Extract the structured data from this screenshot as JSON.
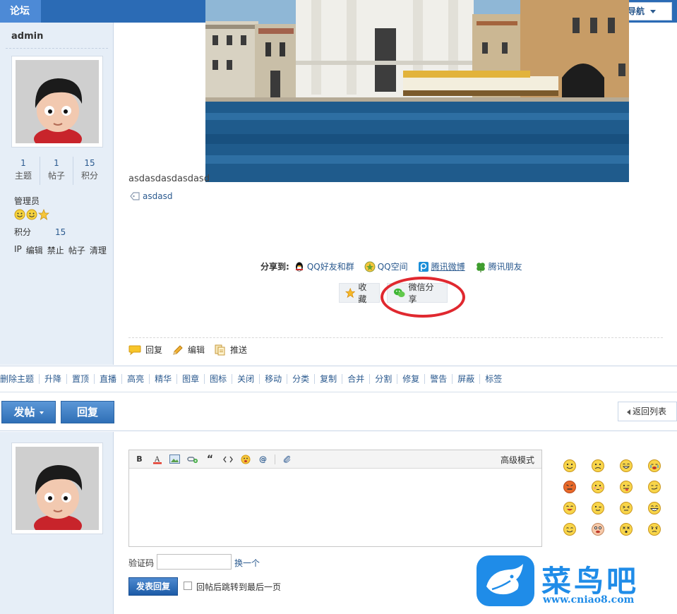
{
  "header": {
    "forum_tab": "论坛",
    "quick_nav": "快捷导航"
  },
  "user": {
    "name": "admin",
    "stats": [
      {
        "value": "1",
        "label": "主题"
      },
      {
        "value": "1",
        "label": "帖子"
      },
      {
        "value": "15",
        "label": "积分"
      }
    ],
    "group": "管理员",
    "score_label": "积分",
    "score_value": "15",
    "admin_links": [
      "IP",
      "编辑",
      "禁止",
      "帖子",
      "清理"
    ]
  },
  "post": {
    "body": "asdasdasdasdasd",
    "tag": "asdasd",
    "share_label": "分享到:",
    "share_targets": [
      "QQ好友和群",
      "QQ空间",
      "腾讯微博",
      "腾讯朋友"
    ],
    "favorite_label": "收藏",
    "wechat_share_label": "微信分享",
    "actions": [
      "回复",
      "编辑",
      "推送"
    ]
  },
  "moderation": [
    "删除主题",
    "升降",
    "置顶",
    "直播",
    "高亮",
    "精华",
    "图章",
    "图标",
    "关闭",
    "移动",
    "分类",
    "复制",
    "合并",
    "分割",
    "修复",
    "警告",
    "屏蔽",
    "标签"
  ],
  "toolbar": {
    "post_new_label": "发帖",
    "reply_label": "回复",
    "back_to_list_label": "返回列表"
  },
  "reply_form": {
    "advanced_mode": "高级模式",
    "editor_value": "",
    "captcha_label": "验证码",
    "captcha_value": "",
    "captcha_refresh": "换一个",
    "submit_label": "发表回复",
    "jump_last_label": "回帖后跳转到最后一页"
  },
  "watermark": {
    "name": "菜鸟吧",
    "url": "www.cniao8.com"
  },
  "colors": {
    "accent": "#2b6bb5",
    "link": "#2b5a8f",
    "highlight_ring": "#e0282f",
    "sidebar_bg": "#e6eef7"
  }
}
